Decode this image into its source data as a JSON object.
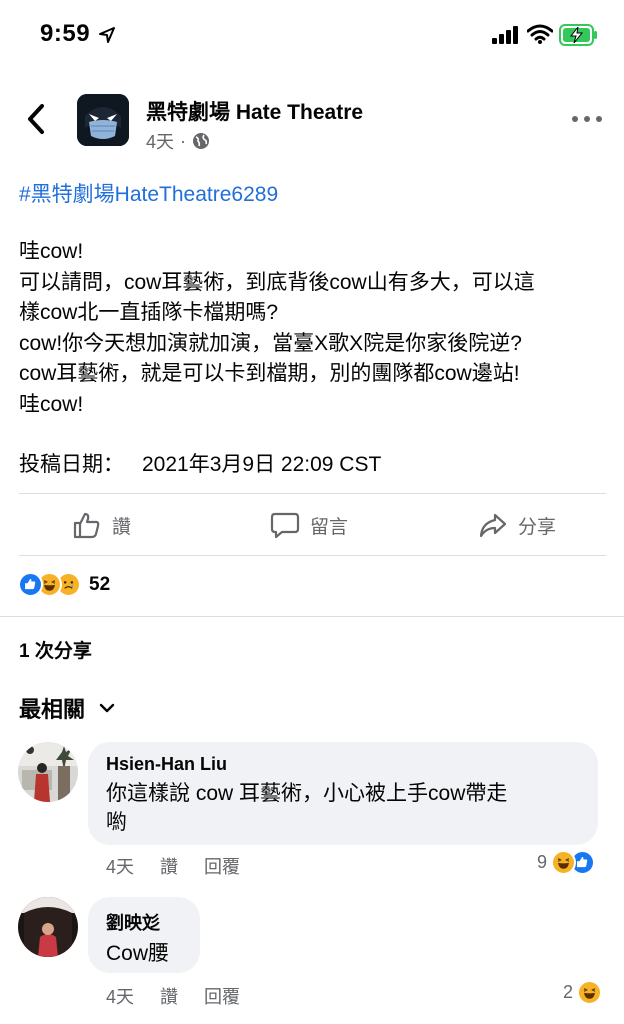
{
  "status_bar": {
    "time": "9:59"
  },
  "post": {
    "page_name": "黑特劇場 Hate Theatre",
    "time": "4天",
    "separator": "·",
    "hashtag": "#黑特劇場HateTheatre6289",
    "body_lines": [
      "哇cow!",
      "可以請問，cow耳藝術，到底背後cow山有多大，可以這",
      "樣cow北一直插隊卡檔期嗎?",
      "cow!你今天想加演就加演，當臺X歌X院是你家後院逆?",
      "cow耳藝術，就是可以卡到檔期，別的團隊都cow邊站!",
      "哇cow!"
    ],
    "date_label": "投稿日期：",
    "date_value": "2021年3月9日 22:09 CST"
  },
  "actions": {
    "like": "讚",
    "comment": "留言",
    "share": "分享"
  },
  "reactions": {
    "count": "52",
    "types": [
      "like-icon",
      "haha-icon",
      "sad-icon"
    ]
  },
  "shares": "1 次分享",
  "sort": {
    "label": "最相關"
  },
  "comments": [
    {
      "author": "Hsien-Han Liu",
      "text_lines": [
        "你這樣說 cow 耳藝術，小心被上手cow帶走",
        "喲"
      ],
      "time": "4天",
      "like": "讚",
      "reply": "回覆",
      "reaction_count": "9"
    },
    {
      "author": "劉映彣",
      "text_lines": [
        "Cow腰"
      ],
      "time": "4天",
      "like": "讚",
      "reply": "回覆",
      "reaction_count": "2"
    }
  ],
  "colors": {
    "link": "#216fdb",
    "like_blue": "#1877f2",
    "haha_yellow": "#f7b125",
    "battery_green": "#34c759"
  }
}
